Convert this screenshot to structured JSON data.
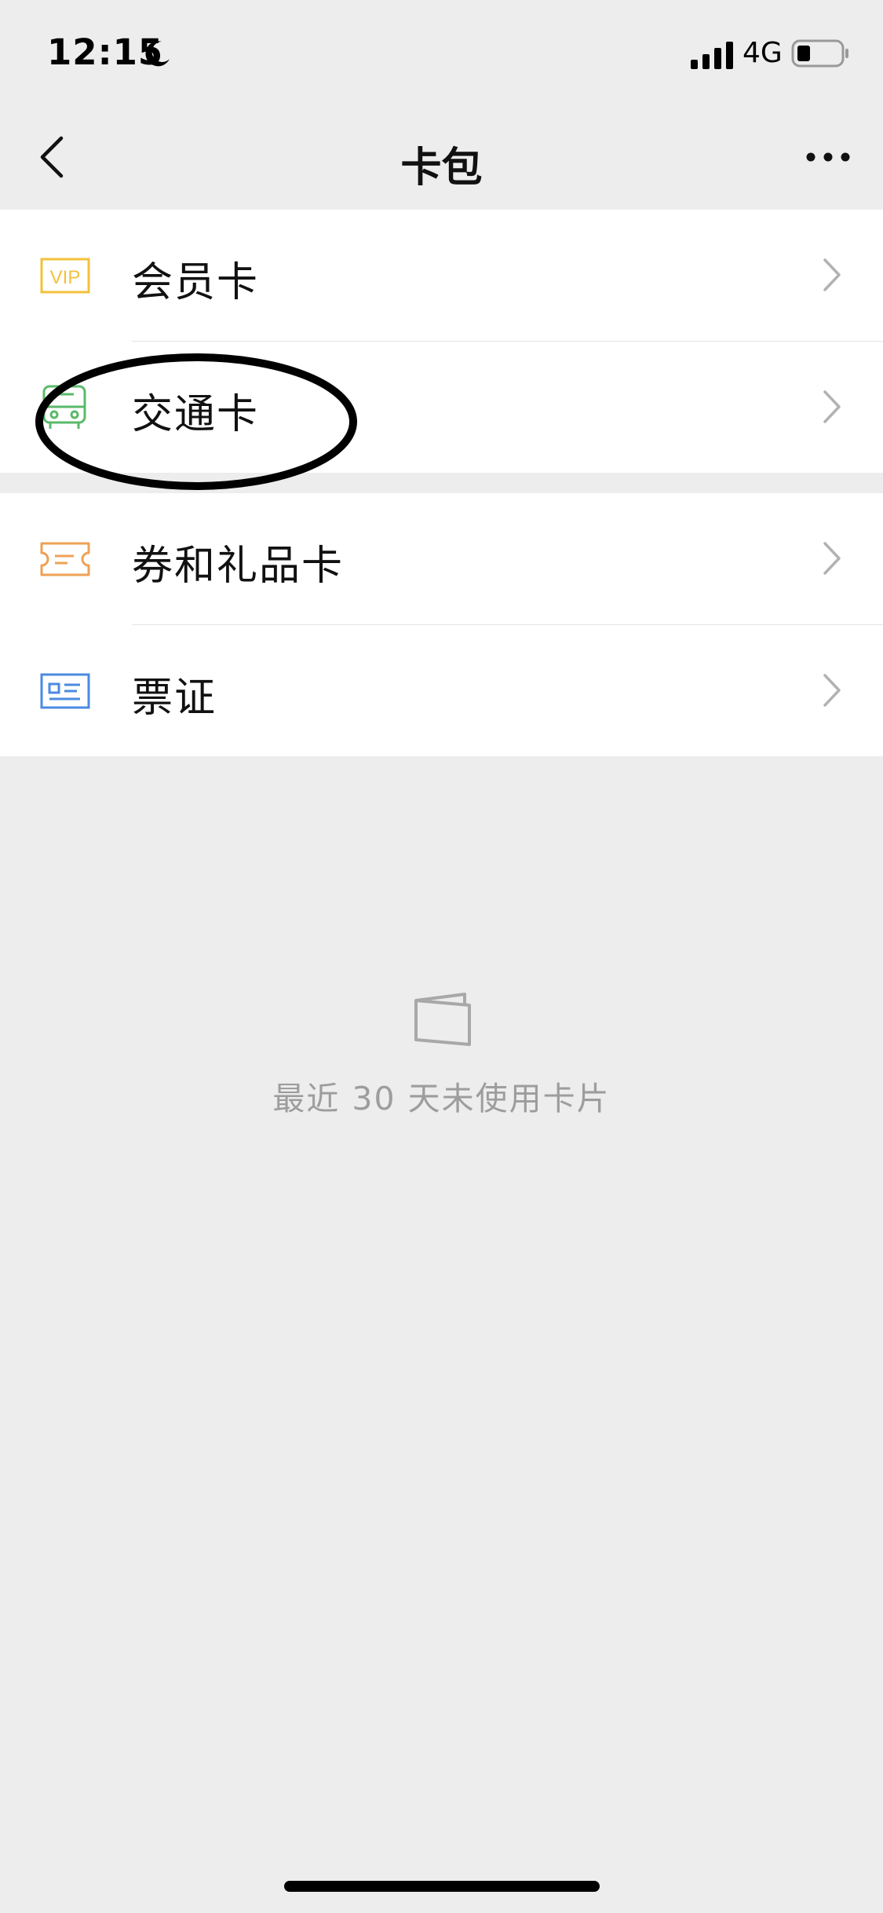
{
  "status_bar": {
    "time": "12:15",
    "network": "4G",
    "icons": [
      "moon-icon",
      "signal-icon",
      "battery-icon"
    ]
  },
  "nav": {
    "title": "卡包",
    "back_icon": "chevron-left-icon",
    "more_icon": "more-dots-icon"
  },
  "groups": [
    {
      "items": [
        {
          "label": "会员卡",
          "icon": "vip-card-icon",
          "color": "#f3c13a"
        },
        {
          "label": "交通卡",
          "icon": "bus-icon",
          "color": "#5aba6b"
        }
      ]
    },
    {
      "items": [
        {
          "label": "券和礼品卡",
          "icon": "coupon-icon",
          "color": "#eea154"
        },
        {
          "label": "票证",
          "icon": "id-card-icon",
          "color": "#4b8ae0"
        }
      ]
    }
  ],
  "empty_state": {
    "text": "最近 30 天未使用卡片",
    "icon": "cards-icon"
  },
  "colors": {
    "background": "#ededed",
    "surface": "#ffffff",
    "annotation": "#000000"
  }
}
